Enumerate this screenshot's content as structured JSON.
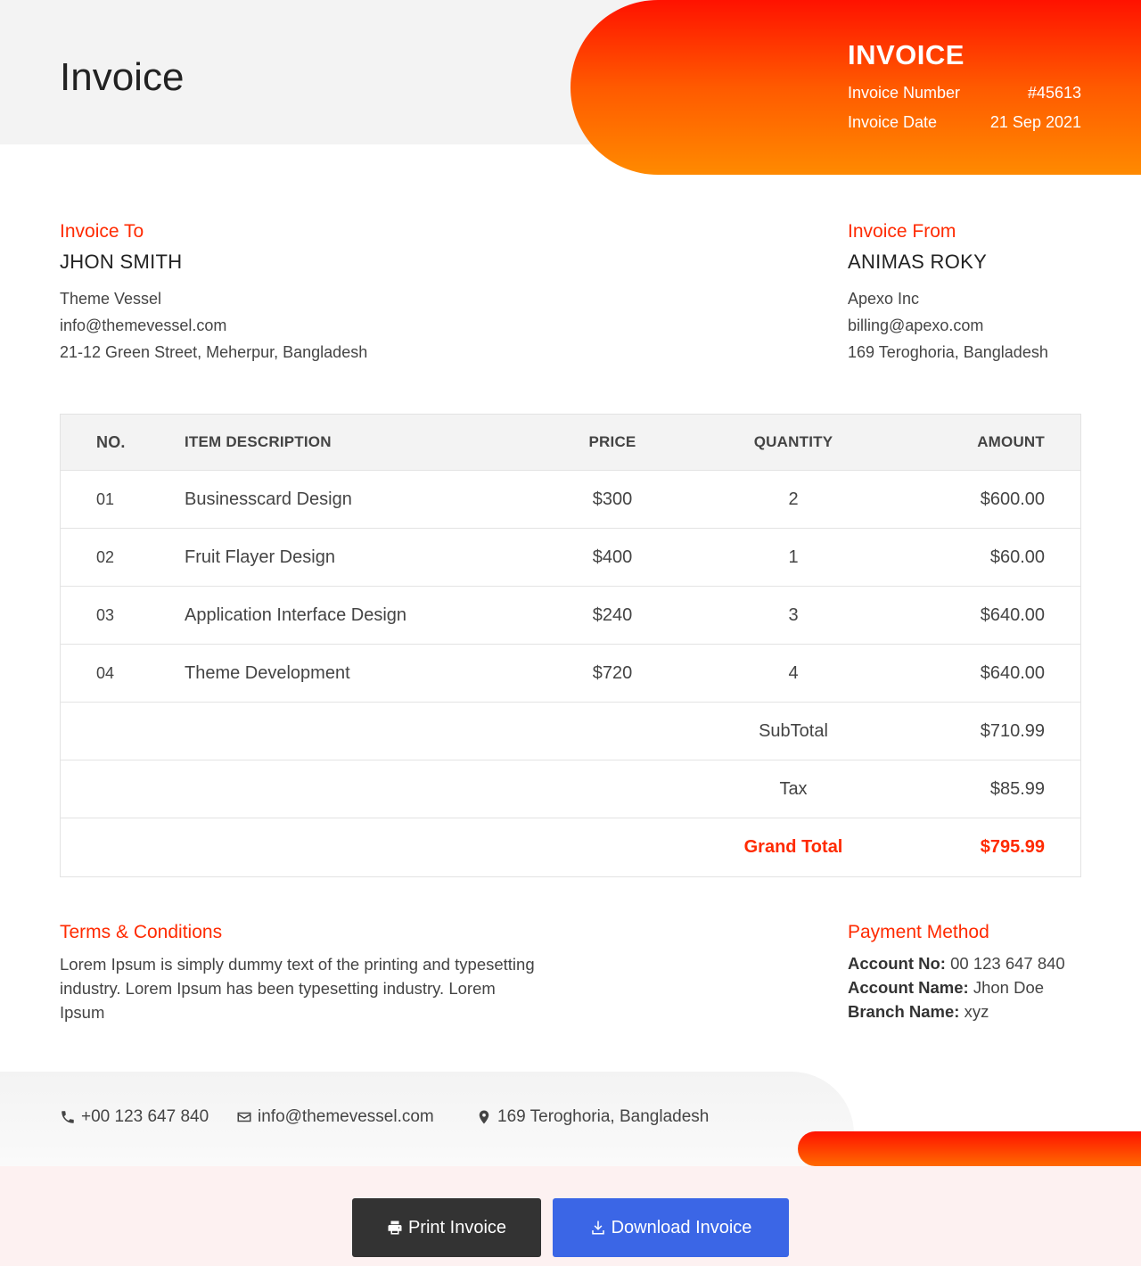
{
  "page_title": "Invoice",
  "invoice": {
    "heading": "INVOICE",
    "number_label": "Invoice Number",
    "number_value": "#45613",
    "date_label": "Invoice Date",
    "date_value": "21 Sep 2021"
  },
  "invoice_to": {
    "label": "Invoice To",
    "name": "JHON SMITH",
    "company": "Theme Vessel",
    "email": "info@themevessel.com",
    "address": "21-12 Green Street, Meherpur, Bangladesh"
  },
  "invoice_from": {
    "label": "Invoice From",
    "name": "ANIMAS ROKY",
    "company": "Apexo Inc",
    "email": "billing@apexo.com",
    "address": "169 Teroghoria, Bangladesh"
  },
  "table": {
    "headers": [
      "NO.",
      "ITEM DESCRIPTION",
      "PRICE",
      "QUANTITY",
      "AMOUNT"
    ],
    "rows": [
      {
        "no": "01",
        "description": "Businesscard Design",
        "price": "$300",
        "quantity": "2",
        "amount": "$600.00"
      },
      {
        "no": "02",
        "description": "Fruit Flayer Design",
        "price": "$400",
        "quantity": "1",
        "amount": "$60.00"
      },
      {
        "no": "03",
        "description": "Application Interface Design",
        "price": "$240",
        "quantity": "3",
        "amount": "$640.00"
      },
      {
        "no": "04",
        "description": "Theme Development",
        "price": "$720",
        "quantity": "4",
        "amount": "$640.00"
      }
    ],
    "subtotal_label": "SubTotal",
    "subtotal_value": "$710.99",
    "tax_label": "Tax",
    "tax_value": "$85.99",
    "grand_total_label": "Grand Total",
    "grand_total_value": "$795.99"
  },
  "terms": {
    "label": "Terms & Conditions",
    "text": "Lorem Ipsum is simply dummy text of the printing and typesetting industry. Lorem Ipsum has been typesetting industry. Lorem Ipsum"
  },
  "payment": {
    "label": "Payment Method",
    "account_no_label": "Account No:",
    "account_no_value": " 00 123 647 840",
    "account_name_label": "Account Name:",
    "account_name_value": " Jhon Doe",
    "branch_name_label": "Branch Name:",
    "branch_name_value": " xyz"
  },
  "footer": {
    "phone": "+00 123 647 840",
    "email": "info@themevessel.com",
    "address": "169 Teroghoria, Bangladesh"
  },
  "buttons": {
    "print": "Print Invoice",
    "download": "Download Invoice"
  },
  "colors": {
    "accent": "#ff2a00",
    "gradient_top": "#ff1200",
    "gradient_bottom": "#ff8a00",
    "print_button": "#333333",
    "download_button": "#3b66e6"
  },
  "icons": [
    "phone-icon",
    "envelope-icon",
    "map-marker-icon",
    "printer-icon",
    "download-icon"
  ]
}
